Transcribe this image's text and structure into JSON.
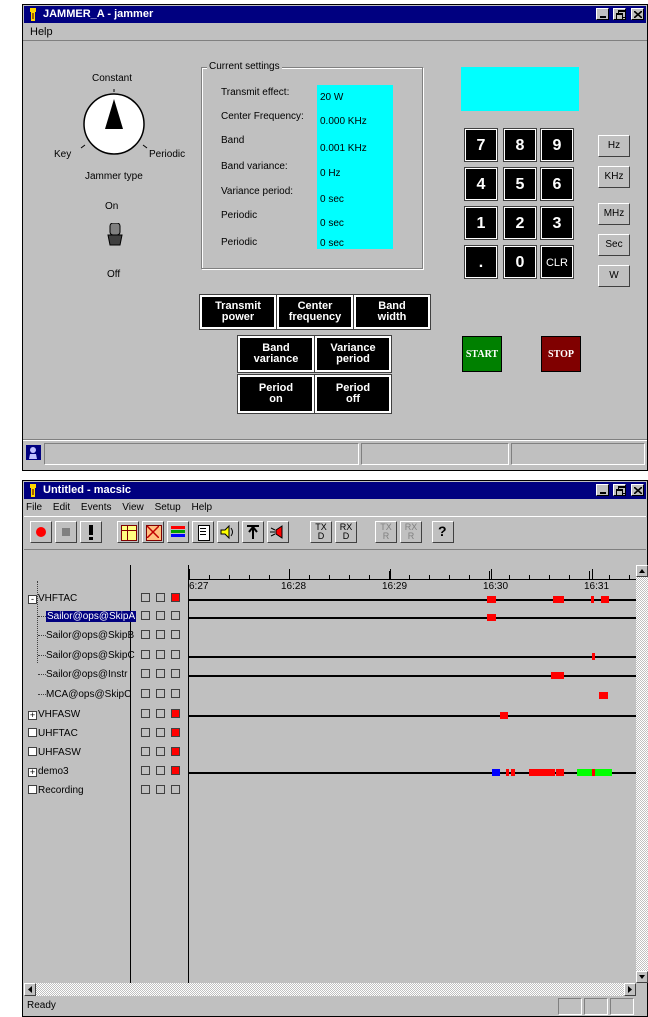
{
  "jammer": {
    "title": "JAMMER_A - jammer",
    "menu": [
      "Help"
    ],
    "dial": {
      "top": "Constant",
      "left": "Key",
      "right": "Periodic",
      "caption": "Jammer type"
    },
    "toggle": {
      "on": "On",
      "off": "Off"
    },
    "settings": {
      "group_title": "Current settings",
      "rows": [
        {
          "label": "Transmit effect:",
          "value": "20 W"
        },
        {
          "label": "Center Frequency:",
          "value": "0.000 KHz"
        },
        {
          "label": "Band",
          "value": "0.001 KHz"
        },
        {
          "label": "Band variance:",
          "value": "0 Hz"
        },
        {
          "label": "Variance period:",
          "value": "0 sec"
        },
        {
          "label": "Periodic",
          "value": "0 sec"
        },
        {
          "label": "Periodic",
          "value": "0 sec"
        }
      ]
    },
    "display_value": "",
    "keypad": [
      "7",
      "8",
      "9",
      "4",
      "5",
      "6",
      "1",
      "2",
      "3",
      ".",
      "0",
      "CLR"
    ],
    "units": [
      "Hz",
      "KHz",
      "MHz",
      "Sec",
      "W"
    ],
    "param_buttons": {
      "transmit_power": "Transmit\npower",
      "center_frequency": "Center\nfrequency",
      "band_width": "Band\nwidth",
      "band_variance": "Band\nvariance",
      "variance_period": "Variance\nperiod",
      "period_on": "Period\non",
      "period_off": "Period\noff"
    },
    "start_label": "START",
    "stop_label": "STOP",
    "colors": {
      "cyan": "#00ffff",
      "start": "#008000",
      "stop": "#800000"
    }
  },
  "macsic": {
    "title": "Untitled - macsic",
    "menu": [
      "File",
      "Edit",
      "Events",
      "View",
      "Setup",
      "Help"
    ],
    "toolbar": {
      "tx_d": "TX\nD",
      "rx_d": "RX\nD",
      "tx_r": "TX\nR",
      "rx_r": "RX\nR"
    },
    "time_ticks": [
      "6:27",
      "16:28",
      "16:29",
      "16:30",
      "16:31"
    ],
    "tree": [
      {
        "label": "VHFTAC",
        "expander": "-",
        "level": 0,
        "ind": [
          0,
          0,
          1
        ]
      },
      {
        "label": "Sailor@ops@SkipA",
        "expander": "",
        "level": 1,
        "selected": true,
        "ind": [
          0,
          0,
          0
        ]
      },
      {
        "label": "Sailor@ops@SkipB",
        "expander": "",
        "level": 1,
        "ind": [
          0,
          0,
          0
        ]
      },
      {
        "label": "Sailor@ops@SkipC",
        "expander": "",
        "level": 1,
        "ind": [
          0,
          0,
          0
        ]
      },
      {
        "label": "Sailor@ops@Instr",
        "expander": "",
        "level": 1,
        "ind": [
          0,
          0,
          0
        ]
      },
      {
        "label": "MCA@ops@SkipC",
        "expander": "",
        "level": 1,
        "ind": [
          0,
          0,
          0
        ]
      },
      {
        "label": "VHFASW",
        "expander": "+",
        "level": 0,
        "ind": [
          0,
          0,
          1
        ]
      },
      {
        "label": "UHFTAC",
        "expander": " ",
        "level": 0,
        "ind": [
          0,
          0,
          1
        ]
      },
      {
        "label": "UHFASW",
        "expander": " ",
        "level": 0,
        "ind": [
          0,
          0,
          1
        ]
      },
      {
        "label": "demo3",
        "expander": "+",
        "level": 0,
        "ind": [
          0,
          0,
          1
        ]
      },
      {
        "label": "Recording",
        "expander": " ",
        "level": 0,
        "ind": [
          0,
          0,
          0
        ]
      }
    ],
    "status": "Ready",
    "colors": {
      "event_red": "#ff0000",
      "event_blue": "#0000ff",
      "event_green": "#00ff00"
    }
  }
}
